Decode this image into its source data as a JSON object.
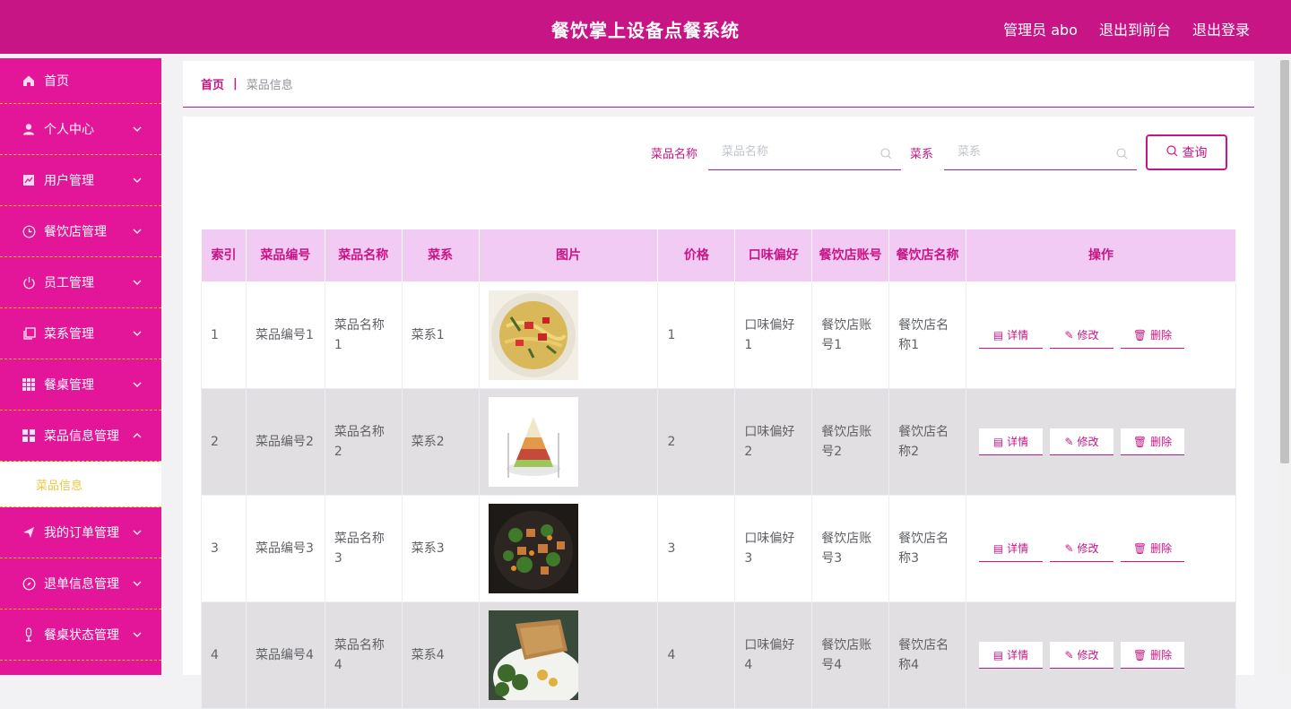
{
  "header": {
    "title": "餐饮掌上设备点餐系统",
    "user": "管理员 abo",
    "to_front": "退出到前台",
    "logout": "退出登录"
  },
  "sidebar": {
    "items": [
      {
        "label": "首页",
        "icon": "home-icon"
      },
      {
        "label": "个人中心",
        "icon": "user-icon"
      },
      {
        "label": "用户管理",
        "icon": "chart-icon"
      },
      {
        "label": "餐饮店管理",
        "icon": "clock-icon"
      },
      {
        "label": "员工管理",
        "icon": "power-icon"
      },
      {
        "label": "菜系管理",
        "icon": "copy-icon"
      },
      {
        "label": "餐桌管理",
        "icon": "grid-icon"
      },
      {
        "label": "菜品信息管理",
        "icon": "apps-icon"
      },
      {
        "label": "我的订单管理",
        "icon": "send-icon"
      },
      {
        "label": "退单信息管理",
        "icon": "compass-icon"
      },
      {
        "label": "餐桌状态管理",
        "icon": "mic-icon"
      }
    ],
    "submenu_label": "菜品信息"
  },
  "breadcrumb": {
    "home": "首页",
    "sep": "|",
    "current": "菜品信息"
  },
  "search": {
    "name_label": "菜品名称",
    "name_placeholder": "菜品名称",
    "cuisine_label": "菜系",
    "cuisine_placeholder": "菜系",
    "button": "查询"
  },
  "table": {
    "headers": [
      "索引",
      "菜品编号",
      "菜品名称",
      "菜系",
      "图片",
      "价格",
      "口味偏好",
      "餐饮店账号",
      "餐饮店名称",
      "操作"
    ],
    "ops": {
      "detail": "详情",
      "edit": "修改",
      "delete": "删除"
    },
    "rows": [
      {
        "index": "1",
        "code": "菜品编号1",
        "name": "菜品名称1",
        "cuisine": "菜系1",
        "price": "1",
        "taste": "口味偏好1",
        "account": "餐饮店账号1",
        "shop": "餐饮店名称1"
      },
      {
        "index": "2",
        "code": "菜品编号2",
        "name": "菜品名称2",
        "cuisine": "菜系2",
        "price": "2",
        "taste": "口味偏好2",
        "account": "餐饮店账号2",
        "shop": "餐饮店名称2"
      },
      {
        "index": "3",
        "code": "菜品编号3",
        "name": "菜品名称3",
        "cuisine": "菜系3",
        "price": "3",
        "taste": "口味偏好3",
        "account": "餐饮店账号3",
        "shop": "餐饮店名称3"
      },
      {
        "index": "4",
        "code": "菜品编号4",
        "name": "菜品名称4",
        "cuisine": "菜系4",
        "price": "4",
        "taste": "口味偏好4",
        "account": "餐饮店账号4",
        "shop": "餐饮店名称4"
      }
    ]
  },
  "colors": {
    "primary": "#c71585",
    "sidebar": "#e3169a",
    "header_bg": "#f2cbf5",
    "alt_row": "#e1dfe1",
    "sub_active": "#e8c840"
  }
}
